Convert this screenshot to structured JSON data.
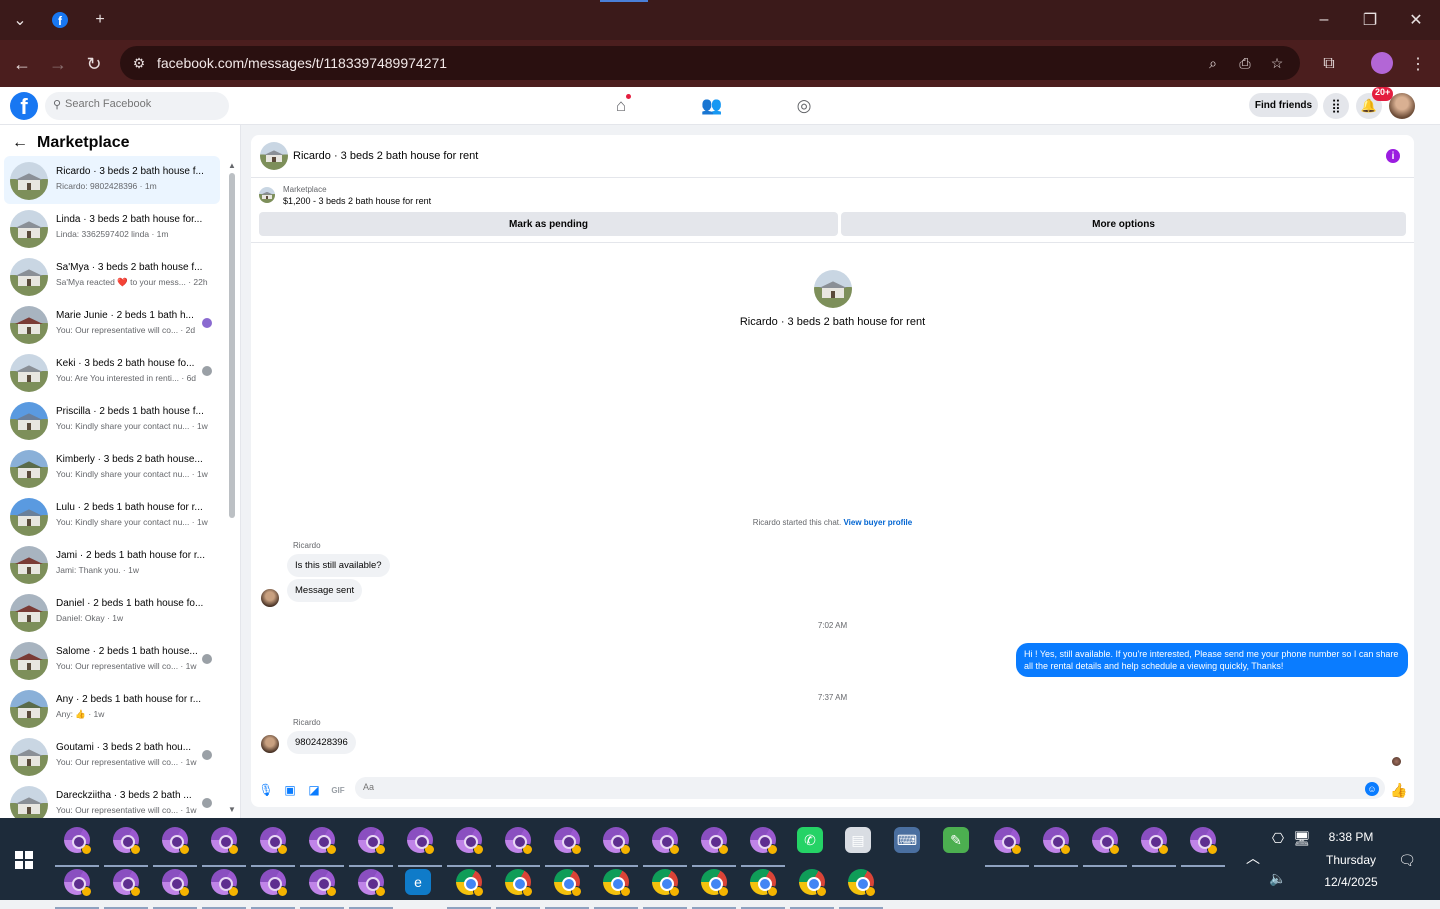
{
  "browser": {
    "url": "facebook.com/messages/t/1183397489974271"
  },
  "fb_header": {
    "search_placeholder": "Search Facebook",
    "find_friends": "Find friends",
    "notif_badge": "20+"
  },
  "sidebar": {
    "title": "Marketplace",
    "conversations": [
      {
        "name": "Ricardo · 3 beds 2 bath house f...",
        "sub": "Ricardo: 9802428396 · 1m",
        "img": "gray"
      },
      {
        "name": "Linda · 3 beds 2 bath house for...",
        "sub": "Linda: 3362597402 linda · 1m",
        "img": "gray"
      },
      {
        "name": "Sa'Mya · 3 beds 2 bath house f...",
        "sub": "Sa'Mya reacted ❤️ to your mess... · 22h",
        "img": "gray"
      },
      {
        "name": "Marie Junie · 2 beds 1 bath h...",
        "sub": "You: Our representative will co... · 2d",
        "img": "red"
      },
      {
        "name": "Keki · 3 beds 2 bath house fo...",
        "sub": "You: Are You interested in renti... · 6d",
        "img": "gray"
      },
      {
        "name": "Priscilla · 2 beds 1 bath house f...",
        "sub": "You: Kindly share your contact nu... · 1w",
        "img": "blue"
      },
      {
        "name": "Kimberly · 3 beds 2 bath house...",
        "sub": "You: Kindly share your contact nu... · 1w",
        "img": "green"
      },
      {
        "name": "Lulu · 2 beds 1 bath house for r...",
        "sub": "You: Kindly share your contact nu... · 1w",
        "img": "blue"
      },
      {
        "name": "Jami · 2 beds 1 bath house for r...",
        "sub": "Jami: Thank you. · 1w",
        "img": "red"
      },
      {
        "name": "Daniel · 2 beds 1 bath house fo...",
        "sub": "Daniel: Okay · 1w",
        "img": "red"
      },
      {
        "name": "Salome · 2 beds 1 bath house...",
        "sub": "You: Our representative will co... · 1w",
        "img": "red"
      },
      {
        "name": "Any · 2 beds 1 bath house for r...",
        "sub": "Any: 👍 · 1w",
        "img": "green"
      },
      {
        "name": "Goutami · 3 beds 2 bath hou...",
        "sub": "You: Our representative will co... · 1w",
        "img": "gray"
      },
      {
        "name": "Dareckziitha · 3 beds 2 bath ...",
        "sub": "You: Our representative will co... · 1w",
        "img": "gray"
      }
    ]
  },
  "chat": {
    "title": "Ricardo · 3 beds 2 bath house for rent",
    "marketplace_label": "Marketplace",
    "listing": "$1,200 - 3 beds 2 bath house for rent",
    "mark_pending": "Mark as pending",
    "more_options": "More options",
    "center_title": "Ricardo · 3 beds 2 bath house for rent",
    "started_text": "Ricardo started this chat.",
    "view_profile": "View buyer profile",
    "sender1": "Ricardo",
    "msg1": "Is this still available?",
    "msg2": "Message sent",
    "time1": "7:02 AM",
    "out_msg": "Hi ! Yes, still available. If you're interested, Please send me your phone number so I can share all the rental details and help schedule a viewing quickly, Thanks!",
    "time2": "7:37 AM",
    "sender2": "Ricardo",
    "msg3": "9802428396",
    "composer_placeholder": "Aa"
  },
  "taskbar": {
    "time": "8:38 PM",
    "day": "Thursday",
    "date": "12/4/2025"
  }
}
